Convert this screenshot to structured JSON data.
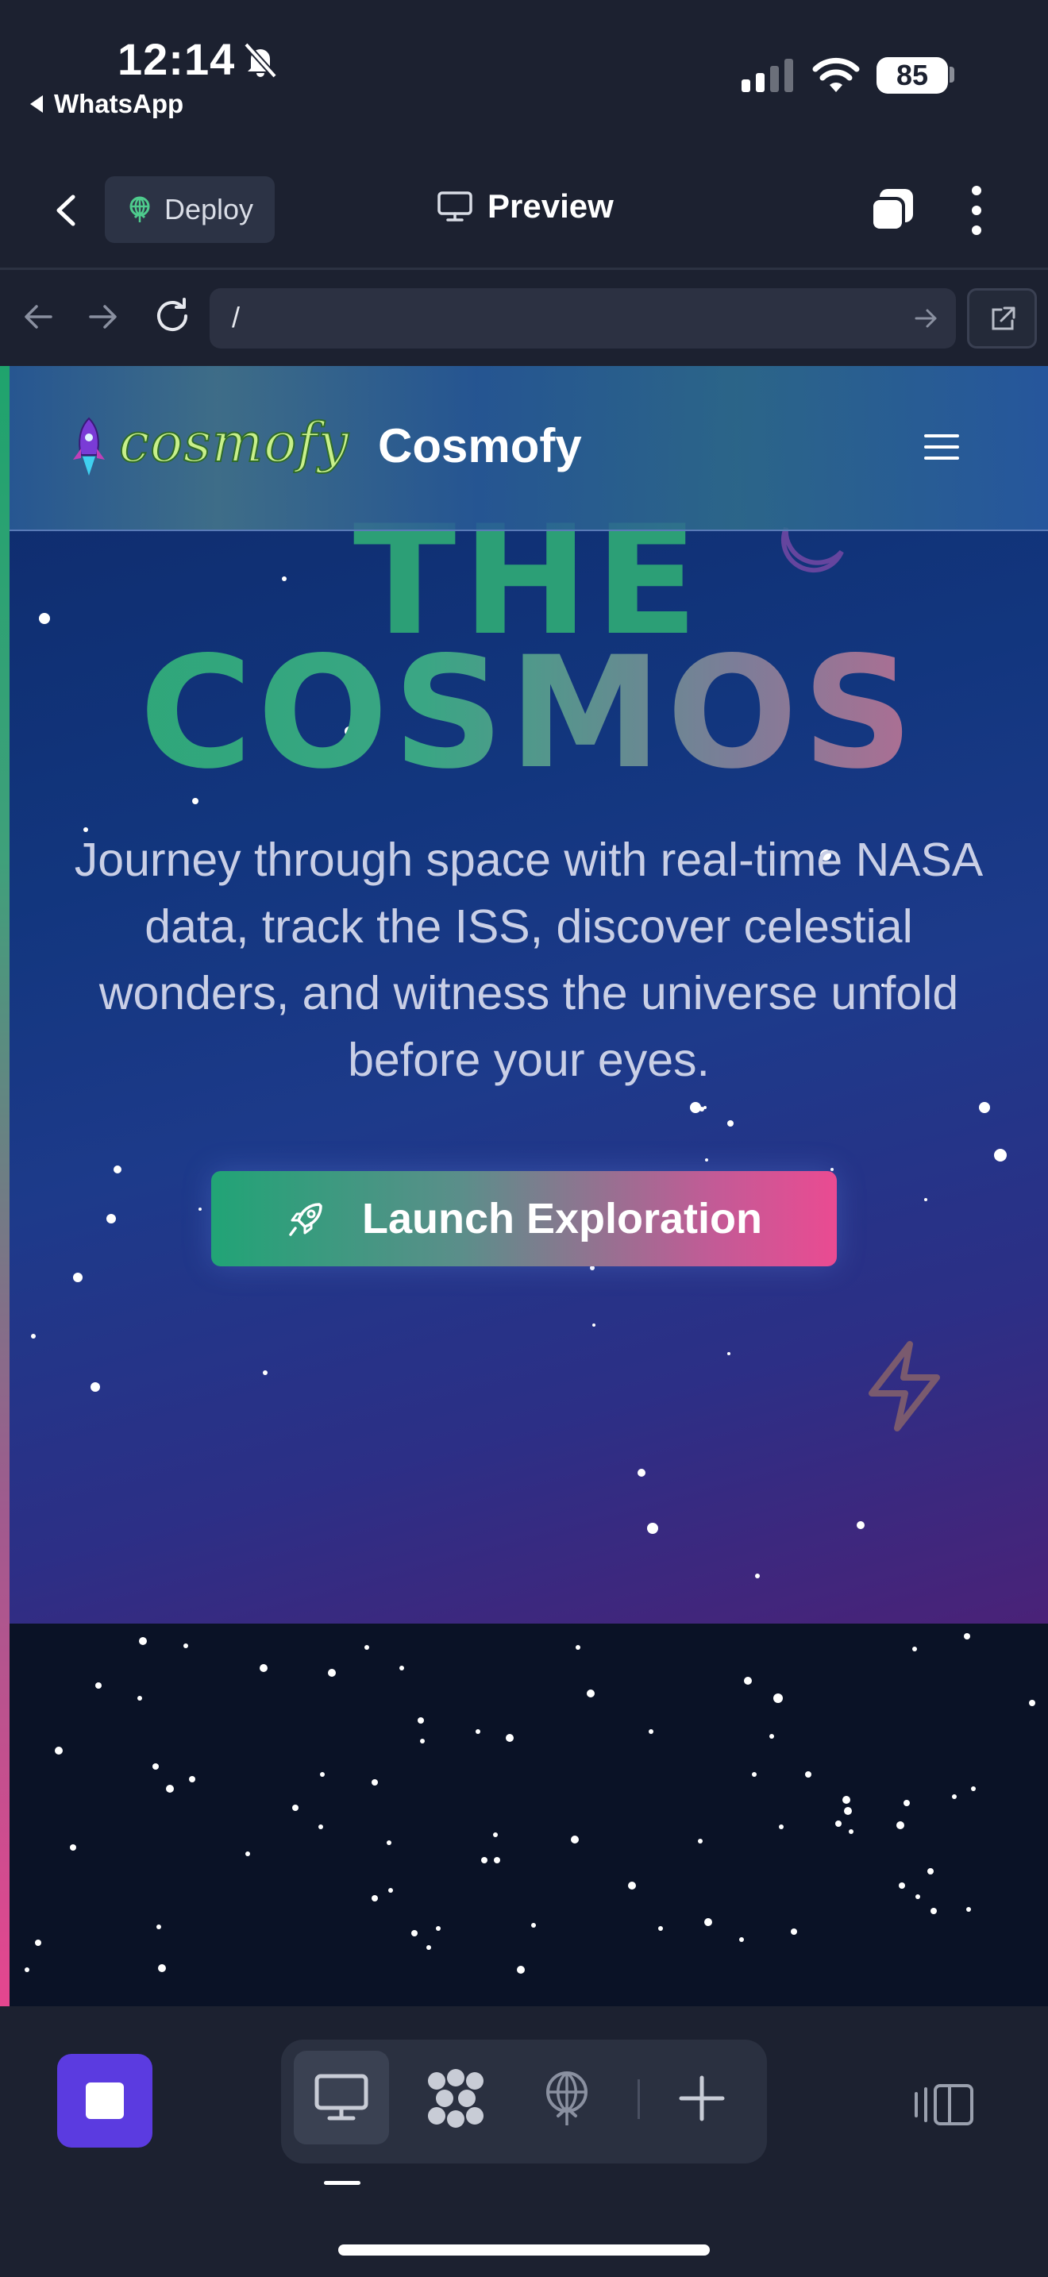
{
  "status_bar": {
    "time": "12:14",
    "back_app": "WhatsApp",
    "battery": "85"
  },
  "toolbar": {
    "deploy_label": "Deploy",
    "preview_label": "Preview"
  },
  "url_bar": {
    "url": "/"
  },
  "site": {
    "brand_logo_text": "cosmofy",
    "brand_name": "Cosmofy",
    "hero_title_line1": "THE",
    "hero_title_line2": "COSMOS",
    "hero_text": "Journey through space with real-time NASA data, track the ISS, discover celestial wonders, and witness the universe unfold before your eyes.",
    "cta_label": "Launch Exploration"
  },
  "colors": {
    "accent_green": "#21a476",
    "accent_pink": "#ea4b92",
    "stop_button": "#5b3be0",
    "app_background": "#1c2130"
  },
  "icons": {
    "status": [
      "bell-slash-icon",
      "cellular-signal-icon",
      "wifi-icon",
      "battery-icon"
    ],
    "toolbar": [
      "chevron-left-icon",
      "deploy-icon",
      "monitor-icon",
      "tabs-icon",
      "more-vertical-icon"
    ],
    "url_bar": [
      "arrow-left-icon",
      "arrow-right-icon",
      "reload-icon",
      "go-arrow-icon",
      "external-link-icon"
    ],
    "bottom_bar": [
      "stop-icon",
      "monitor-icon",
      "components-icon",
      "deploy-icon",
      "plus-icon",
      "panel-toggle-icon"
    ]
  }
}
